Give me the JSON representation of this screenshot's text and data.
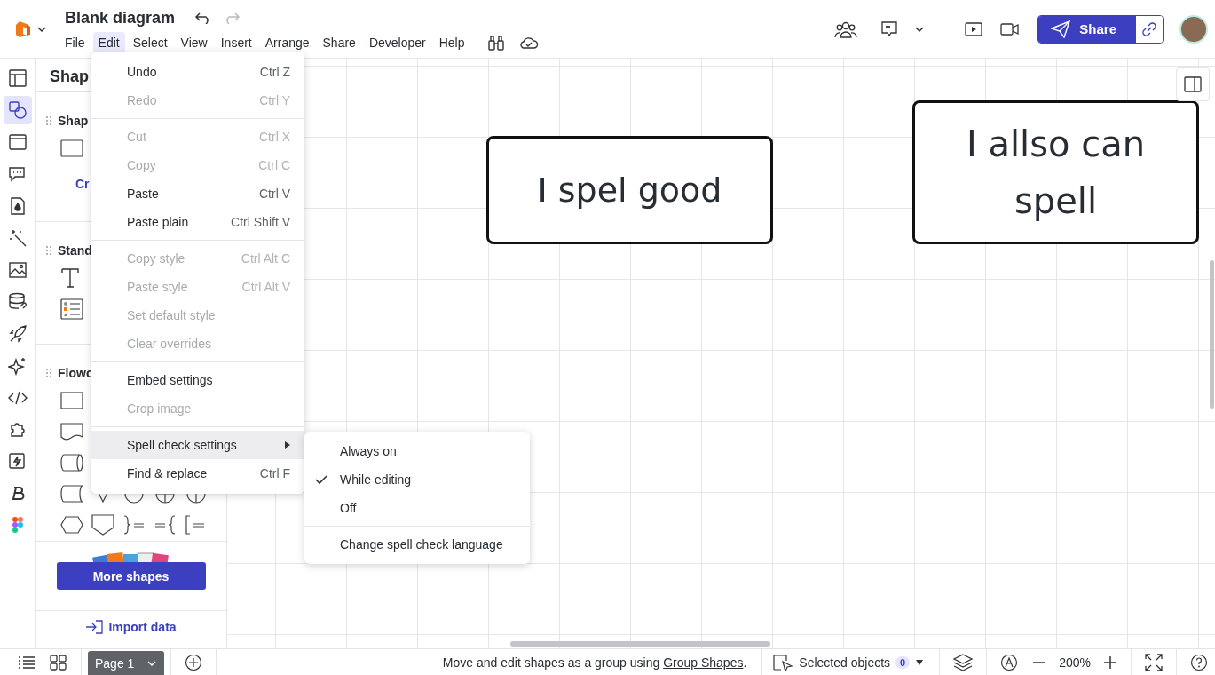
{
  "document": {
    "title": "Blank diagram"
  },
  "menubar": [
    {
      "label": "File",
      "selected": false
    },
    {
      "label": "Edit",
      "selected": true
    },
    {
      "label": "Select",
      "selected": false
    },
    {
      "label": "View",
      "selected": false
    },
    {
      "label": "Insert",
      "selected": false
    },
    {
      "label": "Arrange",
      "selected": false
    },
    {
      "label": "Share",
      "selected": false
    },
    {
      "label": "Developer",
      "selected": false
    },
    {
      "label": "Help",
      "selected": false
    }
  ],
  "share_button": "Share",
  "rail": [
    {
      "kind": "layout",
      "selected": false
    },
    {
      "kind": "shapes",
      "selected": true
    },
    {
      "kind": "frame",
      "selected": false
    },
    {
      "kind": "chat",
      "selected": false
    },
    {
      "kind": "drop",
      "selected": false
    },
    {
      "kind": "wand",
      "selected": false
    },
    {
      "kind": "image",
      "selected": false
    },
    {
      "kind": "data",
      "selected": false
    },
    {
      "kind": "rocket",
      "selected": false
    },
    {
      "kind": "sparkle",
      "selected": false
    },
    {
      "kind": "code",
      "selected": false
    },
    {
      "kind": "puzzle",
      "selected": false
    },
    {
      "kind": "bolt",
      "selected": false
    },
    {
      "kind": "letter",
      "selected": false
    },
    {
      "kind": "figma",
      "selected": false
    }
  ],
  "shapes_panel": {
    "title": "Shap",
    "sections": [
      "Shap",
      "Stand",
      "Flowc"
    ],
    "create_link": "Cr",
    "more_button": "More shapes",
    "import_link": "Import data"
  },
  "edit_menu": [
    {
      "kind": "item",
      "label": "Undo",
      "shortcut": "Ctrl Z",
      "disabled": false,
      "highlighted": false
    },
    {
      "kind": "item",
      "label": "Redo",
      "shortcut": "Ctrl Y",
      "disabled": true,
      "highlighted": false
    },
    {
      "kind": "separator"
    },
    {
      "kind": "item",
      "label": "Cut",
      "shortcut": "Ctrl X",
      "disabled": true,
      "highlighted": false
    },
    {
      "kind": "item",
      "label": "Copy",
      "shortcut": "Ctrl C",
      "disabled": true,
      "highlighted": false
    },
    {
      "kind": "item",
      "label": "Paste",
      "shortcut": "Ctrl V",
      "disabled": false,
      "highlighted": false
    },
    {
      "kind": "item",
      "label": "Paste plain",
      "shortcut": "Ctrl Shift V",
      "disabled": false,
      "highlighted": false
    },
    {
      "kind": "separator"
    },
    {
      "kind": "item",
      "label": "Copy style",
      "shortcut": "Ctrl Alt C",
      "disabled": true,
      "highlighted": false
    },
    {
      "kind": "item",
      "label": "Paste style",
      "shortcut": "Ctrl Alt V",
      "disabled": true,
      "highlighted": false
    },
    {
      "kind": "item",
      "label": "Set default style",
      "disabled": true,
      "highlighted": false
    },
    {
      "kind": "item",
      "label": "Clear overrides",
      "disabled": true,
      "highlighted": false
    },
    {
      "kind": "separator"
    },
    {
      "kind": "item",
      "label": "Embed settings",
      "disabled": false,
      "highlighted": false
    },
    {
      "kind": "item",
      "label": "Crop image",
      "disabled": true,
      "highlighted": false
    },
    {
      "kind": "separator"
    },
    {
      "kind": "submenu",
      "label": "Spell check settings",
      "disabled": false,
      "highlighted": true
    },
    {
      "kind": "item",
      "label": "Find & replace",
      "shortcut": "Ctrl F",
      "disabled": false,
      "highlighted": false
    }
  ],
  "spell_submenu": [
    {
      "kind": "option",
      "label": "Always on",
      "checked": false
    },
    {
      "kind": "option",
      "label": "While editing",
      "checked": true
    },
    {
      "kind": "option",
      "label": "Off",
      "checked": false
    },
    {
      "kind": "separator"
    },
    {
      "kind": "item",
      "label": "Change spell check language"
    }
  ],
  "canvas_shapes": [
    {
      "text": "I spel good"
    },
    {
      "text": "I allso can spell"
    }
  ],
  "status_bar": {
    "page_tab": "Page 1",
    "hint": "Move and edit shapes as a group using ",
    "hint_link": "Group Shapes",
    "hint_end": ".",
    "selection_label": "Selected objects",
    "selection_count": "0",
    "zoom": "200%"
  }
}
